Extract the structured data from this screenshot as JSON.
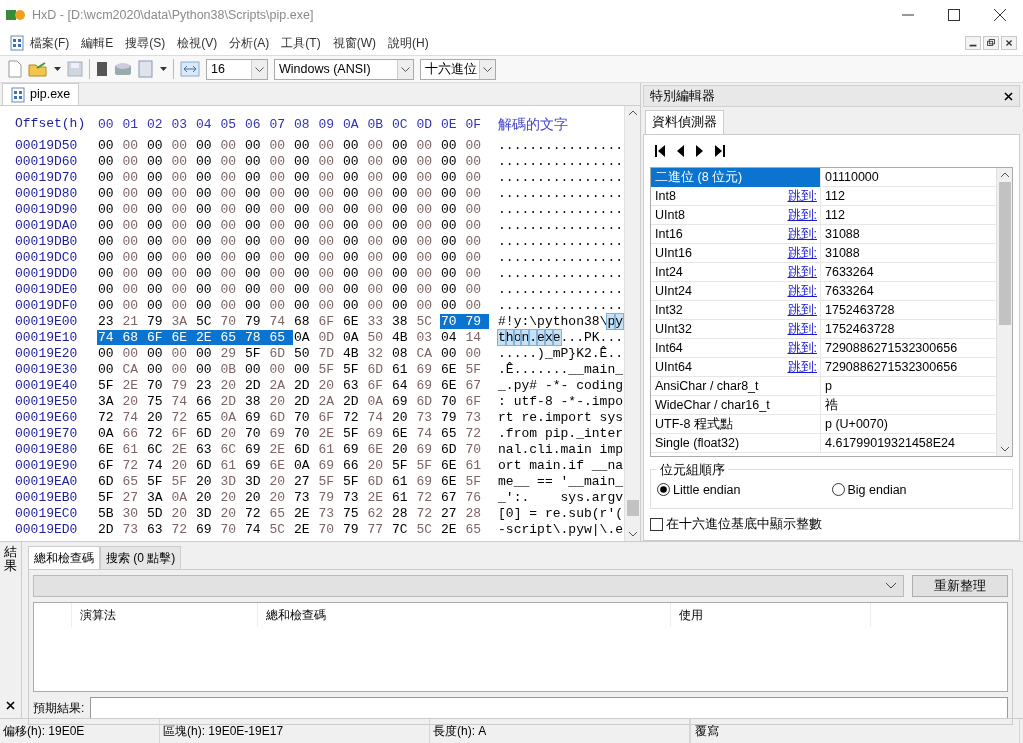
{
  "window": {
    "title": "HxD - [D:\\wcm2020\\data\\Python38\\Scripts\\pip.exe]"
  },
  "menu": [
    "檔案(F)",
    "編輯E",
    "搜尋(S)",
    "檢視(V)",
    "分析(A)",
    "工具(T)",
    "視窗(W)",
    "說明(H)"
  ],
  "toolbar": {
    "bytes_per_row": "16",
    "charset": "Windows (ANSI)",
    "offset_base": "十六進位"
  },
  "file_tabs": [
    {
      "label": "pip.exe",
      "selected": true
    }
  ],
  "hex_view": {
    "offset_header": "Offset(h)",
    "column_headers": [
      "00",
      "01",
      "02",
      "03",
      "04",
      "05",
      "06",
      "07",
      "08",
      "09",
      "0A",
      "0B",
      "0C",
      "0D",
      "0E",
      "0F"
    ],
    "text_header": "解碼的文字",
    "rows": [
      {
        "offset": "00019D50",
        "bytes": [
          "00",
          "00",
          "00",
          "00",
          "00",
          "00",
          "00",
          "00",
          "00",
          "00",
          "00",
          "00",
          "00",
          "00",
          "00",
          "00"
        ],
        "text": "................",
        "selected": [
          false,
          false,
          false,
          false,
          false,
          false,
          false,
          false,
          false,
          false,
          false,
          false,
          false,
          false,
          false,
          false
        ]
      },
      {
        "offset": "00019D60",
        "bytes": [
          "00",
          "00",
          "00",
          "00",
          "00",
          "00",
          "00",
          "00",
          "00",
          "00",
          "00",
          "00",
          "00",
          "00",
          "00",
          "00"
        ],
        "text": "................",
        "selected": [
          false,
          false,
          false,
          false,
          false,
          false,
          false,
          false,
          false,
          false,
          false,
          false,
          false,
          false,
          false,
          false
        ]
      },
      {
        "offset": "00019D70",
        "bytes": [
          "00",
          "00",
          "00",
          "00",
          "00",
          "00",
          "00",
          "00",
          "00",
          "00",
          "00",
          "00",
          "00",
          "00",
          "00",
          "00"
        ],
        "text": "................",
        "selected": [
          false,
          false,
          false,
          false,
          false,
          false,
          false,
          false,
          false,
          false,
          false,
          false,
          false,
          false,
          false,
          false
        ]
      },
      {
        "offset": "00019D80",
        "bytes": [
          "00",
          "00",
          "00",
          "00",
          "00",
          "00",
          "00",
          "00",
          "00",
          "00",
          "00",
          "00",
          "00",
          "00",
          "00",
          "00"
        ],
        "text": "................",
        "selected": [
          false,
          false,
          false,
          false,
          false,
          false,
          false,
          false,
          false,
          false,
          false,
          false,
          false,
          false,
          false,
          false
        ]
      },
      {
        "offset": "00019D90",
        "bytes": [
          "00",
          "00",
          "00",
          "00",
          "00",
          "00",
          "00",
          "00",
          "00",
          "00",
          "00",
          "00",
          "00",
          "00",
          "00",
          "00"
        ],
        "text": "................",
        "selected": [
          false,
          false,
          false,
          false,
          false,
          false,
          false,
          false,
          false,
          false,
          false,
          false,
          false,
          false,
          false,
          false
        ]
      },
      {
        "offset": "00019DA0",
        "bytes": [
          "00",
          "00",
          "00",
          "00",
          "00",
          "00",
          "00",
          "00",
          "00",
          "00",
          "00",
          "00",
          "00",
          "00",
          "00",
          "00"
        ],
        "text": "................",
        "selected": [
          false,
          false,
          false,
          false,
          false,
          false,
          false,
          false,
          false,
          false,
          false,
          false,
          false,
          false,
          false,
          false
        ]
      },
      {
        "offset": "00019DB0",
        "bytes": [
          "00",
          "00",
          "00",
          "00",
          "00",
          "00",
          "00",
          "00",
          "00",
          "00",
          "00",
          "00",
          "00",
          "00",
          "00",
          "00"
        ],
        "text": "................",
        "selected": [
          false,
          false,
          false,
          false,
          false,
          false,
          false,
          false,
          false,
          false,
          false,
          false,
          false,
          false,
          false,
          false
        ]
      },
      {
        "offset": "00019DC0",
        "bytes": [
          "00",
          "00",
          "00",
          "00",
          "00",
          "00",
          "00",
          "00",
          "00",
          "00",
          "00",
          "00",
          "00",
          "00",
          "00",
          "00"
        ],
        "text": "................",
        "selected": [
          false,
          false,
          false,
          false,
          false,
          false,
          false,
          false,
          false,
          false,
          false,
          false,
          false,
          false,
          false,
          false
        ]
      },
      {
        "offset": "00019DD0",
        "bytes": [
          "00",
          "00",
          "00",
          "00",
          "00",
          "00",
          "00",
          "00",
          "00",
          "00",
          "00",
          "00",
          "00",
          "00",
          "00",
          "00"
        ],
        "text": "................",
        "selected": [
          false,
          false,
          false,
          false,
          false,
          false,
          false,
          false,
          false,
          false,
          false,
          false,
          false,
          false,
          false,
          false
        ]
      },
      {
        "offset": "00019DE0",
        "bytes": [
          "00",
          "00",
          "00",
          "00",
          "00",
          "00",
          "00",
          "00",
          "00",
          "00",
          "00",
          "00",
          "00",
          "00",
          "00",
          "00"
        ],
        "text": "................",
        "selected": [
          false,
          false,
          false,
          false,
          false,
          false,
          false,
          false,
          false,
          false,
          false,
          false,
          false,
          false,
          false,
          false
        ]
      },
      {
        "offset": "00019DF0",
        "bytes": [
          "00",
          "00",
          "00",
          "00",
          "00",
          "00",
          "00",
          "00",
          "00",
          "00",
          "00",
          "00",
          "00",
          "00",
          "00",
          "00"
        ],
        "text": "................",
        "selected": [
          false,
          false,
          false,
          false,
          false,
          false,
          false,
          false,
          false,
          false,
          false,
          false,
          false,
          false,
          false,
          false
        ]
      },
      {
        "offset": "00019E00",
        "bytes": [
          "23",
          "21",
          "79",
          "3A",
          "5C",
          "70",
          "79",
          "74",
          "68",
          "6F",
          "6E",
          "33",
          "38",
          "5C",
          "70",
          "79"
        ],
        "text": "#!y:\\python38\\py",
        "selected": [
          false,
          false,
          false,
          false,
          false,
          false,
          false,
          false,
          false,
          false,
          false,
          false,
          false,
          false,
          true,
          true
        ]
      },
      {
        "offset": "00019E10",
        "bytes": [
          "74",
          "68",
          "6F",
          "6E",
          "2E",
          "65",
          "78",
          "65",
          "0A",
          "0D",
          "0A",
          "50",
          "4B",
          "03",
          "04",
          "14"
        ],
        "text": "thon.exe...PK...",
        "selected": [
          true,
          true,
          true,
          true,
          true,
          true,
          true,
          true,
          false,
          false,
          false,
          false,
          false,
          false,
          false,
          false
        ]
      },
      {
        "offset": "00019E20",
        "bytes": [
          "00",
          "00",
          "00",
          "00",
          "00",
          "29",
          "5F",
          "6D",
          "50",
          "7D",
          "4B",
          "32",
          "08",
          "CA",
          "00",
          "00"
        ],
        "text": ".....)_mP}K2.Ê..",
        "selected": [
          false,
          false,
          false,
          false,
          false,
          false,
          false,
          false,
          false,
          false,
          false,
          false,
          false,
          false,
          false,
          false
        ]
      },
      {
        "offset": "00019E30",
        "bytes": [
          "00",
          "CA",
          "00",
          "00",
          "00",
          "0B",
          "00",
          "00",
          "00",
          "5F",
          "5F",
          "6D",
          "61",
          "69",
          "6E",
          "5F"
        ],
        "text": ".Ê.......__main_",
        "selected": [
          false,
          false,
          false,
          false,
          false,
          false,
          false,
          false,
          false,
          false,
          false,
          false,
          false,
          false,
          false,
          false
        ]
      },
      {
        "offset": "00019E40",
        "bytes": [
          "5F",
          "2E",
          "70",
          "79",
          "23",
          "20",
          "2D",
          "2A",
          "2D",
          "20",
          "63",
          "6F",
          "64",
          "69",
          "6E",
          "67"
        ],
        "text": "_.py# -*- coding",
        "selected": [
          false,
          false,
          false,
          false,
          false,
          false,
          false,
          false,
          false,
          false,
          false,
          false,
          false,
          false,
          false,
          false
        ]
      },
      {
        "offset": "00019E50",
        "bytes": [
          "3A",
          "20",
          "75",
          "74",
          "66",
          "2D",
          "38",
          "20",
          "2D",
          "2A",
          "2D",
          "0A",
          "69",
          "6D",
          "70",
          "6F"
        ],
        "text": ": utf-8 -*-.impo",
        "selected": [
          false,
          false,
          false,
          false,
          false,
          false,
          false,
          false,
          false,
          false,
          false,
          false,
          false,
          false,
          false,
          false
        ]
      },
      {
        "offset": "00019E60",
        "bytes": [
          "72",
          "74",
          "20",
          "72",
          "65",
          "0A",
          "69",
          "6D",
          "70",
          "6F",
          "72",
          "74",
          "20",
          "73",
          "79",
          "73"
        ],
        "text": "rt re.import sys",
        "selected": [
          false,
          false,
          false,
          false,
          false,
          false,
          false,
          false,
          false,
          false,
          false,
          false,
          false,
          false,
          false,
          false
        ]
      },
      {
        "offset": "00019E70",
        "bytes": [
          "0A",
          "66",
          "72",
          "6F",
          "6D",
          "20",
          "70",
          "69",
          "70",
          "2E",
          "5F",
          "69",
          "6E",
          "74",
          "65",
          "72"
        ],
        "text": ".from pip._inter",
        "selected": [
          false,
          false,
          false,
          false,
          false,
          false,
          false,
          false,
          false,
          false,
          false,
          false,
          false,
          false,
          false,
          false
        ]
      },
      {
        "offset": "00019E80",
        "bytes": [
          "6E",
          "61",
          "6C",
          "2E",
          "63",
          "6C",
          "69",
          "2E",
          "6D",
          "61",
          "69",
          "6E",
          "20",
          "69",
          "6D",
          "70"
        ],
        "text": "nal.cli.main imp",
        "selected": [
          false,
          false,
          false,
          false,
          false,
          false,
          false,
          false,
          false,
          false,
          false,
          false,
          false,
          false,
          false,
          false
        ]
      },
      {
        "offset": "00019E90",
        "bytes": [
          "6F",
          "72",
          "74",
          "20",
          "6D",
          "61",
          "69",
          "6E",
          "0A",
          "69",
          "66",
          "20",
          "5F",
          "5F",
          "6E",
          "61"
        ],
        "text": "ort main.if __na",
        "selected": [
          false,
          false,
          false,
          false,
          false,
          false,
          false,
          false,
          false,
          false,
          false,
          false,
          false,
          false,
          false,
          false
        ]
      },
      {
        "offset": "00019EA0",
        "bytes": [
          "6D",
          "65",
          "5F",
          "5F",
          "20",
          "3D",
          "3D",
          "20",
          "27",
          "5F",
          "5F",
          "6D",
          "61",
          "69",
          "6E",
          "5F"
        ],
        "text": "me__ == '__main_",
        "selected": [
          false,
          false,
          false,
          false,
          false,
          false,
          false,
          false,
          false,
          false,
          false,
          false,
          false,
          false,
          false,
          false
        ]
      },
      {
        "offset": "00019EB0",
        "bytes": [
          "5F",
          "27",
          "3A",
          "0A",
          "20",
          "20",
          "20",
          "20",
          "73",
          "79",
          "73",
          "2E",
          "61",
          "72",
          "67",
          "76"
        ],
        "text": "_':.    sys.argv",
        "selected": [
          false,
          false,
          false,
          false,
          false,
          false,
          false,
          false,
          false,
          false,
          false,
          false,
          false,
          false,
          false,
          false
        ]
      },
      {
        "offset": "00019EC0",
        "bytes": [
          "5B",
          "30",
          "5D",
          "20",
          "3D",
          "20",
          "72",
          "65",
          "2E",
          "73",
          "75",
          "62",
          "28",
          "72",
          "27",
          "28"
        ],
        "text": "[0] = re.sub(r'(",
        "selected": [
          false,
          false,
          false,
          false,
          false,
          false,
          false,
          false,
          false,
          false,
          false,
          false,
          false,
          false,
          false,
          false
        ]
      },
      {
        "offset": "00019ED0",
        "bytes": [
          "2D",
          "73",
          "63",
          "72",
          "69",
          "70",
          "74",
          "5C",
          "2E",
          "70",
          "79",
          "77",
          "7C",
          "5C",
          "2E",
          "65"
        ],
        "text": "-script\\.pyw|\\.e",
        "selected": [
          false,
          false,
          false,
          false,
          false,
          false,
          false,
          false,
          false,
          false,
          false,
          false,
          false,
          false,
          false,
          false
        ]
      }
    ]
  },
  "inspector": {
    "title": "特別編輯器",
    "tabs": [
      {
        "label": "資料偵測器",
        "selected": true
      }
    ],
    "rows": [
      {
        "type": "二進位 (8 位元)",
        "value": "01110000",
        "selected": true
      },
      {
        "type": "Int8",
        "jump": "跳到:",
        "value": "112",
        "selected": false
      },
      {
        "type": "UInt8",
        "jump": "跳到:",
        "value": "112",
        "selected": false
      },
      {
        "type": "Int16",
        "jump": "跳到:",
        "value": "31088",
        "selected": false
      },
      {
        "type": "UInt16",
        "jump": "跳到:",
        "value": "31088",
        "selected": false
      },
      {
        "type": "Int24",
        "jump": "跳到:",
        "value": "7633264",
        "selected": false
      },
      {
        "type": "UInt24",
        "jump": "跳到:",
        "value": "7633264",
        "selected": false
      },
      {
        "type": "Int32",
        "jump": "跳到:",
        "value": "1752463728",
        "selected": false
      },
      {
        "type": "UInt32",
        "jump": "跳到:",
        "value": "1752463728",
        "selected": false
      },
      {
        "type": "Int64",
        "jump": "跳到:",
        "value": "7290886271532300656",
        "selected": false
      },
      {
        "type": "UInt64",
        "jump": "跳到:",
        "value": "7290886271532300656",
        "selected": false
      },
      {
        "type": "AnsiChar / char8_t",
        "value": "p",
        "selected": false
      },
      {
        "type": "WideChar / char16_t",
        "value": "祰",
        "selected": false
      },
      {
        "type": "UTF-8 程式點",
        "value": "p (U+0070)",
        "selected": false
      },
      {
        "type": "Single (float32)",
        "value": "4.61799019321458E24",
        "selected": false
      }
    ],
    "byte_order": {
      "label": "位元組順序",
      "options": [
        {
          "label": "Little endian",
          "selected": true
        },
        {
          "label": "Big endian",
          "selected": false
        }
      ]
    },
    "hex_checkbox": {
      "label": "在十六進位基底中顯示整數",
      "checked": false
    }
  },
  "results": {
    "side_label": "結果",
    "tabs": [
      {
        "label": "總和檢查碼",
        "selected": true
      },
      {
        "label": "搜索 (0 點擊)",
        "selected": false
      }
    ],
    "refresh_button": "重新整理",
    "columns": [
      "演算法",
      "總和檢查碼",
      "使用"
    ],
    "expected_label": "預期結果:"
  },
  "status_bar": [
    "偏移(h): 19E0E",
    "區塊(h): 19E0E-19E17",
    "長度(h): A",
    "覆寫"
  ]
}
